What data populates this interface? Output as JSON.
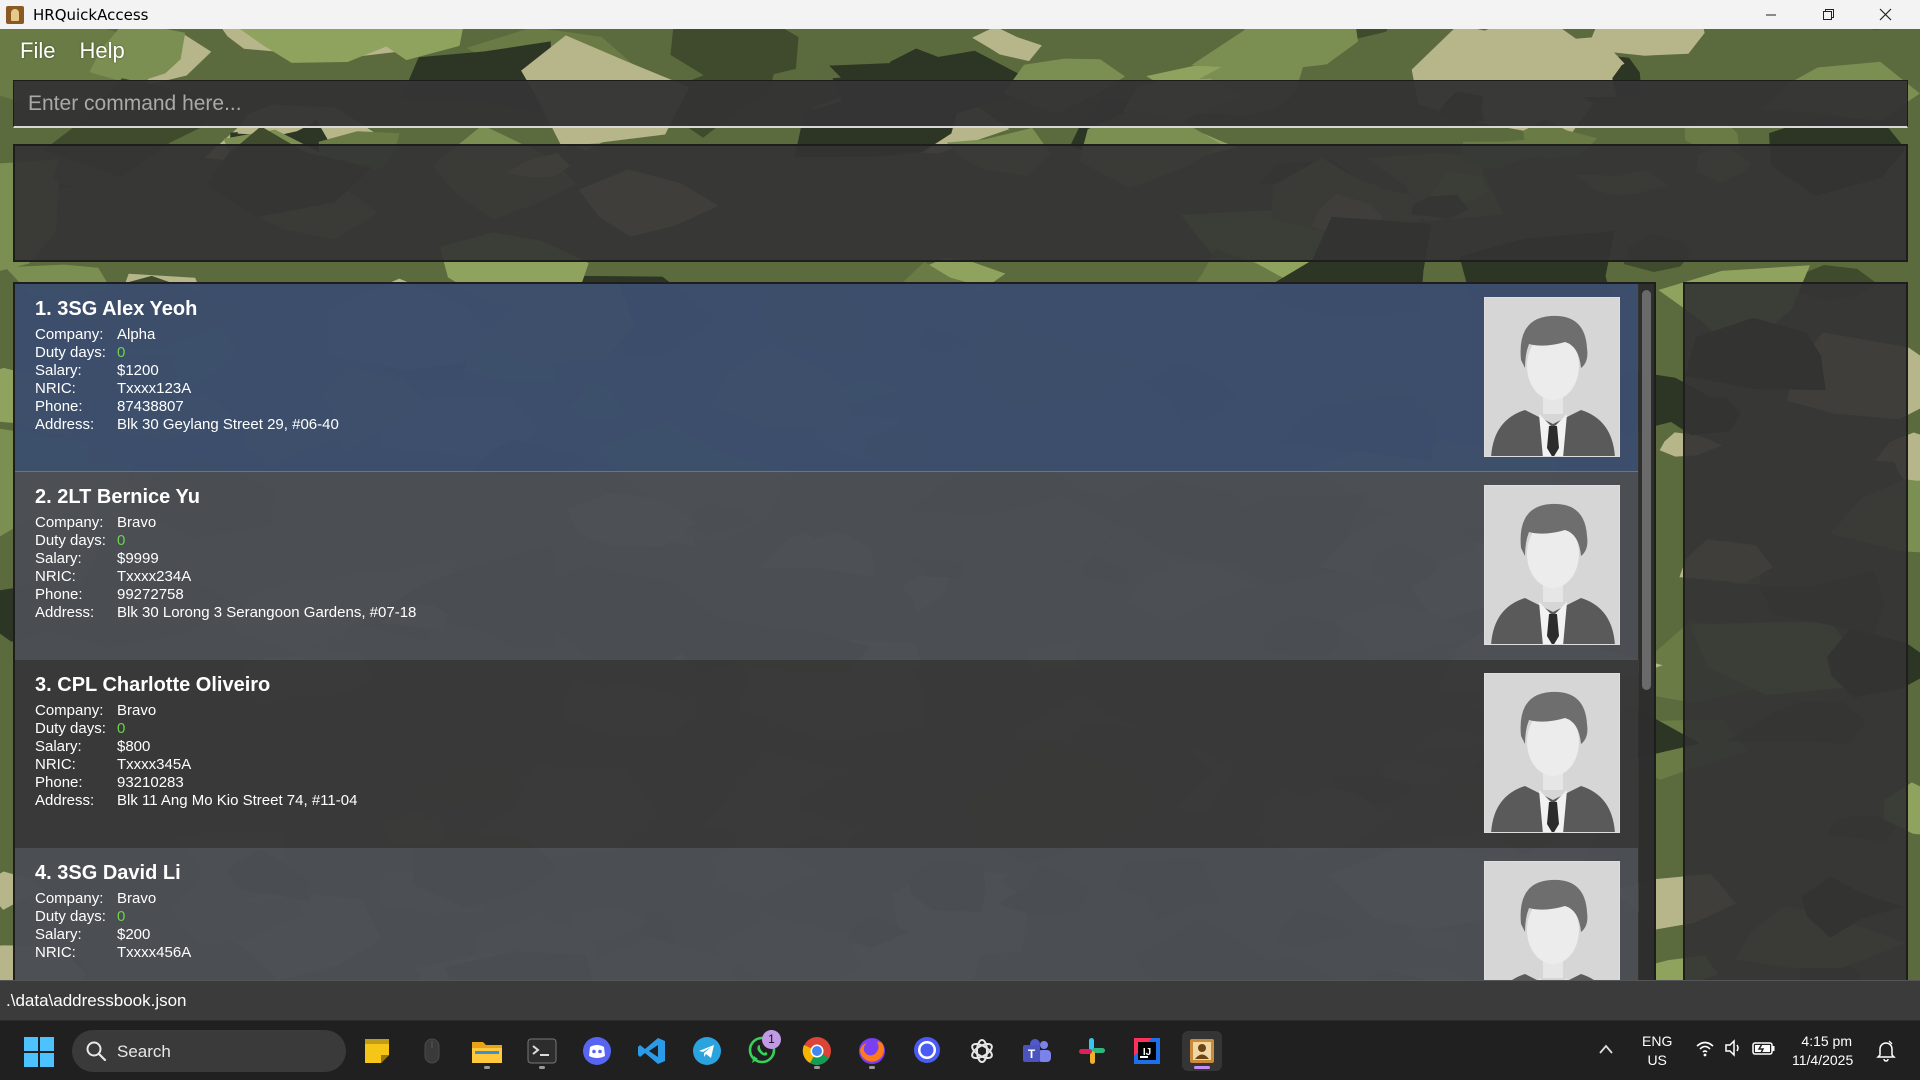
{
  "window": {
    "title": "HRQuickAccess"
  },
  "menu": {
    "file": "File",
    "help": "Help"
  },
  "command": {
    "placeholder": "Enter command here..."
  },
  "persons": [
    {
      "index": "1.",
      "rank": "3SG",
      "name": "Alex Yeoh",
      "company": "Alpha",
      "duty_days": "0",
      "salary": "$1200",
      "nric": "Txxxx123A",
      "phone": "87438807",
      "address": "Blk 30 Geylang Street 29, #06-40"
    },
    {
      "index": "2.",
      "rank": "2LT",
      "name": "Bernice Yu",
      "company": "Bravo",
      "duty_days": "0",
      "salary": "$9999",
      "nric": "Txxxx234A",
      "phone": "99272758",
      "address": "Blk 30 Lorong 3 Serangoon Gardens, #07-18"
    },
    {
      "index": "3.",
      "rank": "CPL",
      "name": "Charlotte Oliveiro",
      "company": "Bravo",
      "duty_days": "0",
      "salary": "$800",
      "nric": "Txxxx345A",
      "phone": "93210283",
      "address": "Blk 11 Ang Mo Kio Street 74, #11-04"
    },
    {
      "index": "4.",
      "rank": "3SG",
      "name": "David Li",
      "company": "Bravo",
      "duty_days": "0",
      "salary": "$200",
      "nric": "Txxxx456A"
    }
  ],
  "labels": {
    "company": "Company:",
    "duty_days": "Duty days:",
    "salary": "Salary:",
    "nric": "NRIC:",
    "phone": "Phone:",
    "address": "Address:"
  },
  "status": {
    "file_path": ".\\data\\addressbook.json"
  },
  "taskbar": {
    "search_label": "Search",
    "whatsapp_badge": "1",
    "lang_line1": "ENG",
    "lang_line2": "US",
    "time": "4:15 pm",
    "date": "11/4/2025"
  },
  "colors": {
    "selected_card": "#3e5374",
    "duty_value": "#6bd34a",
    "accent_active_app": "#c68ef5"
  },
  "icons": {
    "tray": [
      "chevron-up-icon",
      "wifi-icon",
      "volume-icon",
      "battery-icon",
      "notification-icon"
    ]
  }
}
